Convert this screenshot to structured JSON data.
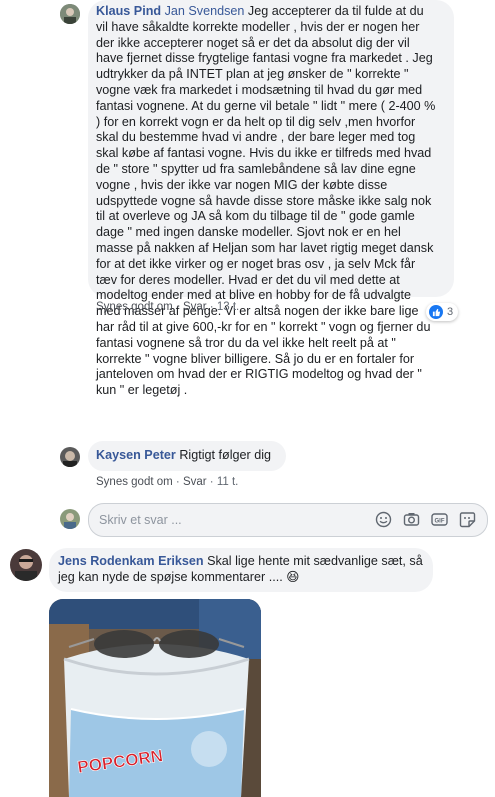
{
  "comment1": {
    "author": "Klaus Pind",
    "tagged": "Jan Svendsen",
    "lines": [
      " Jeg accepterer da til fulde at du",
      "vil have såkaldte korrekte modeller , hvis der er nogen her",
      "der ikke accepterer noget så er det da absolut dig der vil",
      "have fjernet disse frygtelige fantasi vogne fra markedet . Jeg",
      "udtrykker da på INTET plan at jeg ønsker de \" korrekte \"",
      "vogne væk fra markedet i modsætning til hvad du gør med",
      "fantasi vognene. At du gerne vil betale \" lidt \" mere ( 2-400 %",
      ") for en korrekt vogn er da helt op til dig selv ,men hvorfor",
      "skal du bestemme hvad vi andre , der bare leger med tog",
      "skal købe af fantasi vogne. Hvis du ikke er tilfreds med hvad",
      "de \" store \" spytter ud fra samlebåndene så lav dine egne",
      "vogne , hvis der ikke var nogen MIG der købte disse",
      "udspyttede vogne så havde disse store måske ikke salg nok",
      "til at overleve og JA så kom du tilbage til de \" gode gamle",
      "dage \" med ingen danske modeller. Sjovt nok er en hel",
      "masse på nakken af Heljan som har lavet rigtig meget dansk",
      "for at det ikke virker og er noget bras osv , ja selv Mck får",
      "tæv for deres modeller. Hvad er det du vil med dette at",
      "modeltog ender med at blive en hobby for de få udvalgte",
      "med masser af penge. Vi er altså nogen der ikke bare lige",
      "har råd til at give 600,-kr for en \" korrekt \" vogn og fjerner du",
      "fantasi vognene så tror du da vel ikke helt reelt på at \"",
      "korrekte \" vogne bliver billigere. Så jo du er en fortaler for",
      "janteloven om hvad der er RIGTIG modeltog og hvad der \"",
      "kun \" er legetøj ."
    ],
    "like": "Synes godt om",
    "reply": "Svar",
    "time": "13 t.",
    "reaction_count": "3"
  },
  "comment2": {
    "author": "Kaysen Peter",
    "text": "Rigtigt følger dig",
    "like": "Synes godt om",
    "reply": "Svar",
    "time": "11 t."
  },
  "reply_box": {
    "placeholder": "Skriv et svar ..."
  },
  "comment3": {
    "author": "Jens Rodenkam Eriksen",
    "line1": " Skal lige hente mit sædvanlige sæt, så",
    "line2": "jeg kan nyde de spøjse kommentarer ....",
    "emoji": "😆",
    "image_text": "POPCORN"
  },
  "colors": {
    "link": "#385898",
    "bubble": "#f2f3f5",
    "like_blue": "#1877f2"
  }
}
